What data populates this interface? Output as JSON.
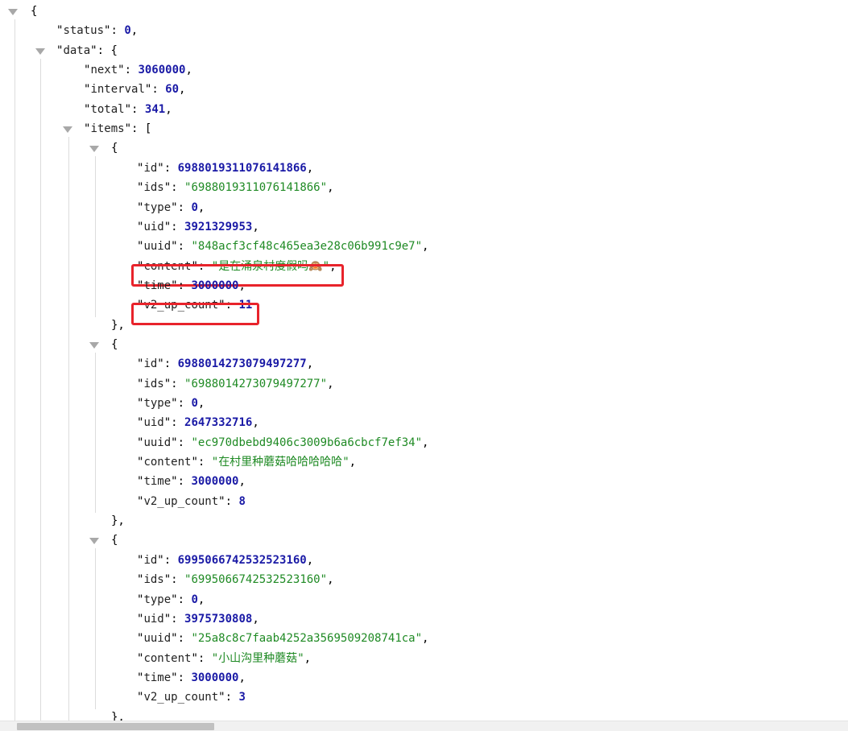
{
  "json_viewer": {
    "lines": [
      {
        "toggle": true,
        "open": "{"
      },
      {
        "key": "status",
        "value": "0",
        "kind": "num",
        "comma": true
      },
      {
        "toggle": true,
        "key": "data",
        "open": "{"
      },
      {
        "key": "next",
        "value": "3060000",
        "kind": "num",
        "comma": true
      },
      {
        "key": "interval",
        "value": "60",
        "kind": "num",
        "comma": true
      },
      {
        "key": "total",
        "value": "341",
        "kind": "num",
        "comma": true
      },
      {
        "toggle": true,
        "key": "items",
        "open": "["
      },
      {
        "toggle": true,
        "open": "{"
      },
      {
        "key": "id",
        "value": "6988019311076141866",
        "kind": "num",
        "comma": true
      },
      {
        "key": "ids",
        "value": "6988019311076141866",
        "kind": "str",
        "comma": true
      },
      {
        "key": "type",
        "value": "0",
        "kind": "num",
        "comma": true
      },
      {
        "key": "uid",
        "value": "3921329953",
        "kind": "num",
        "comma": true
      },
      {
        "key": "uuid",
        "value": "848acf3cf48c465ea3e28c06b991c9e7",
        "kind": "str",
        "comma": true
      },
      {
        "key": "content",
        "value": "是在涌泉村度假吗🙈",
        "kind": "str",
        "comma": true,
        "highlight": true
      },
      {
        "key": "time",
        "value": "3000000",
        "kind": "num",
        "comma": true
      },
      {
        "key": "v2_up_count",
        "value": "11",
        "kind": "num",
        "comma": false,
        "highlight": true
      },
      {
        "close": "},"
      },
      {
        "toggle": true,
        "open": "{"
      },
      {
        "key": "id",
        "value": "6988014273079497277",
        "kind": "num",
        "comma": true
      },
      {
        "key": "ids",
        "value": "6988014273079497277",
        "kind": "str",
        "comma": true
      },
      {
        "key": "type",
        "value": "0",
        "kind": "num",
        "comma": true
      },
      {
        "key": "uid",
        "value": "2647332716",
        "kind": "num",
        "comma": true
      },
      {
        "key": "uuid",
        "value": "ec970dbebd9406c3009b6a6cbcf7ef34",
        "kind": "str",
        "comma": true
      },
      {
        "key": "content",
        "value": "在村里种蘑菇哈哈哈哈哈",
        "kind": "str",
        "comma": true
      },
      {
        "key": "time",
        "value": "3000000",
        "kind": "num",
        "comma": true
      },
      {
        "key": "v2_up_count",
        "value": "8",
        "kind": "num",
        "comma": false
      },
      {
        "close": "},"
      },
      {
        "toggle": true,
        "open": "{"
      },
      {
        "key": "id",
        "value": "6995066742532523160",
        "kind": "num",
        "comma": true
      },
      {
        "key": "ids",
        "value": "6995066742532523160",
        "kind": "str",
        "comma": true
      },
      {
        "key": "type",
        "value": "0",
        "kind": "num",
        "comma": true
      },
      {
        "key": "uid",
        "value": "3975730808",
        "kind": "num",
        "comma": true
      },
      {
        "key": "uuid",
        "value": "25a8c8c7faab4252a3569509208741ca",
        "kind": "str",
        "comma": true
      },
      {
        "key": "content",
        "value": "小山沟里种蘑菇",
        "kind": "str",
        "comma": true
      },
      {
        "key": "time",
        "value": "3000000",
        "kind": "num",
        "comma": true
      },
      {
        "key": "v2_up_count",
        "value": "3",
        "kind": "num",
        "comma": false
      },
      {
        "close": "},"
      }
    ]
  },
  "colors": {
    "number": "#1a1aa6",
    "string": "#1f8a24",
    "highlight": "#e8232b",
    "guide": "#dcdcdc",
    "toggle": "#a8a8a8"
  },
  "icons": {
    "toggle": "triangle-down-icon"
  }
}
